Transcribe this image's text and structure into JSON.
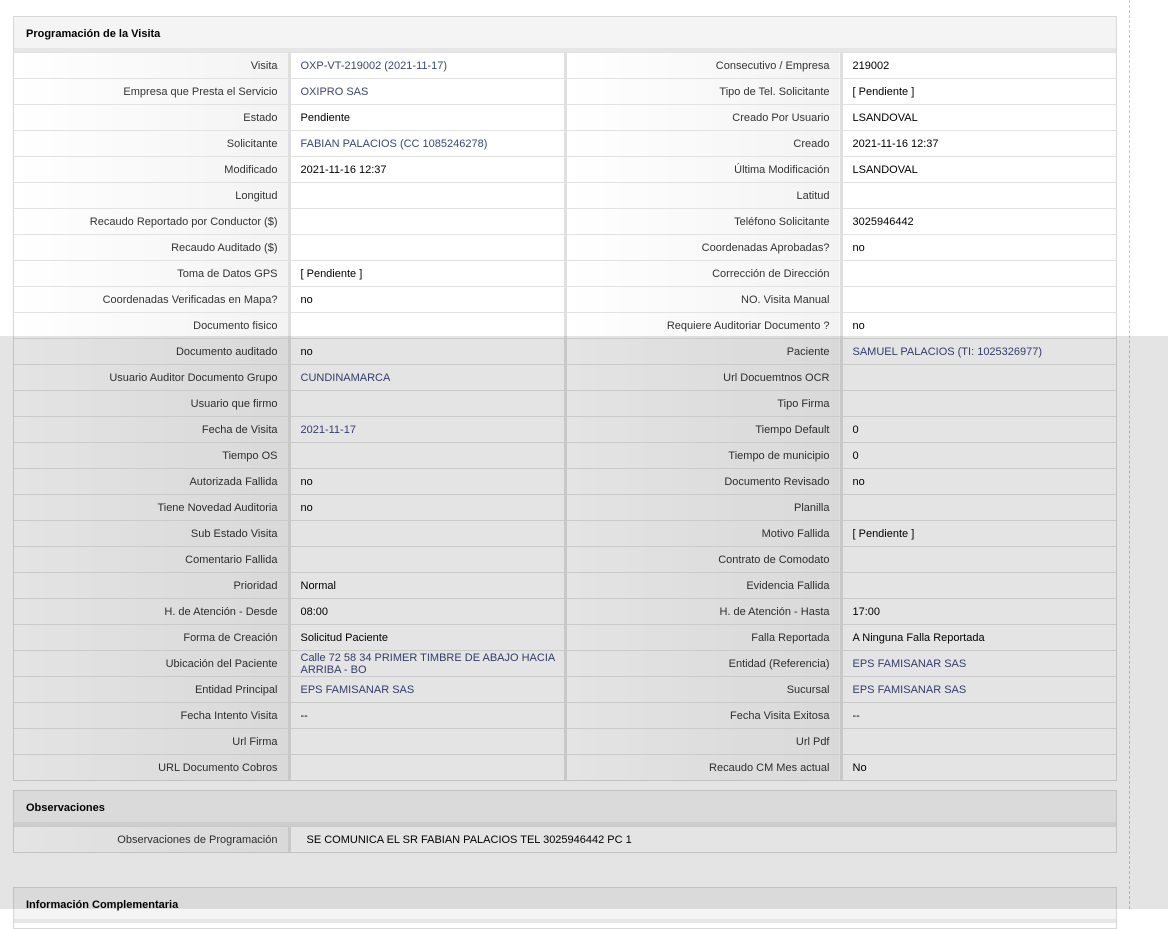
{
  "section1": {
    "title": "Programación de la Visita",
    "rows": [
      {
        "l_label": "Visita",
        "l_value": "OXP-VT-219002 (2021-11-17)",
        "r_label": "Consecutivo / Empresa",
        "r_value": "219002"
      },
      {
        "l_label": "Empresa que Presta el Servicio",
        "l_value": "OXIPRO SAS",
        "r_label": "Tipo de Tel. Solicitante",
        "r_value": "[ Pendiente ]"
      },
      {
        "l_label": "Estado",
        "l_value": "Pendiente",
        "r_label": "Creado Por Usuario",
        "r_value": "LSANDOVAL"
      },
      {
        "l_label": "Solicitante",
        "l_value": "FABIAN PALACIOS (CC 1085246278)",
        "r_label": "Creado",
        "r_value": "2021-11-16 12:37"
      },
      {
        "l_label": "Modificado",
        "l_value": "2021-11-16 12:37",
        "r_label": "Última Modificación",
        "r_value": " LSANDOVAL"
      },
      {
        "l_label": "Longitud",
        "l_value": "",
        "r_label": "Latitud",
        "r_value": ""
      },
      {
        "l_label": "Recaudo Reportado por Conductor ($)",
        "l_value": "",
        "r_label": "Teléfono Solicitante",
        "r_value": "3025946442"
      },
      {
        "l_label": "Recaudo Auditado ($)",
        "l_value": "",
        "r_label": "Coordenadas Aprobadas?",
        "r_value": "no"
      },
      {
        "l_label": "Toma de Datos GPS",
        "l_value": "[ Pendiente ]",
        "r_label": "Corrección de Dirección",
        "r_value": ""
      },
      {
        "l_label": "Coordenadas Verificadas en Mapa?",
        "l_value": "no",
        "r_label": "NO. Visita Manual",
        "r_value": ""
      },
      {
        "l_label": "Documento fisico",
        "l_value": "",
        "r_label": "Requiere Auditoriar Documento ?",
        "r_value": "no"
      },
      {
        "l_label": "Documento auditado",
        "l_value": "no",
        "r_label": "Paciente",
        "r_value": "SAMUEL PALACIOS (TI: 1025326977)"
      },
      {
        "l_label": "Usuario Auditor Documento Grupo",
        "l_value": "CUNDINAMARCA",
        "r_label": "Url Docuemtnos OCR",
        "r_value": ""
      },
      {
        "l_label": "Usuario que firmo",
        "l_value": "",
        "r_label": "Tipo Firma",
        "r_value": ""
      },
      {
        "l_label": "Fecha de Visita",
        "l_value": "2021-11-17",
        "r_label": "Tiempo Default",
        "r_value": "0"
      },
      {
        "l_label": "Tiempo OS",
        "l_value": "",
        "r_label": "Tiempo de municipio",
        "r_value": "0"
      },
      {
        "l_label": "Autorizada Fallida",
        "l_value": "no",
        "r_label": "Documento Revisado",
        "r_value": "no"
      },
      {
        "l_label": "Tiene Novedad Auditoria",
        "l_value": "no",
        "r_label": "Planilla",
        "r_value": ""
      },
      {
        "l_label": "Sub Estado Visita",
        "l_value": "",
        "r_label": "Motivo Fallida",
        "r_value": "[ Pendiente ]"
      },
      {
        "l_label": "Comentario Fallida",
        "l_value": "",
        "r_label": "Contrato de Comodato",
        "r_value": ""
      },
      {
        "l_label": "Prioridad",
        "l_value": "Normal",
        "r_label": "Evidencia Fallida",
        "r_value": ""
      },
      {
        "l_label": "H. de Atención - Desde",
        "l_value": "08:00",
        "r_label": "H. de Atención - Hasta",
        "r_value": "17:00"
      },
      {
        "l_label": "Forma de Creación",
        "l_value": "Solicitud Paciente",
        "r_label": "Falla Reportada",
        "r_value": "A Ninguna Falla Reportada"
      },
      {
        "l_label": "Ubicación del Paciente",
        "l_value": "Calle 72 58 34 PRIMER TIMBRE DE ABAJO HACIA ARRIBA - BO",
        "r_label": "Entidad (Referencia)",
        "r_value": "EPS FAMISANAR SAS"
      },
      {
        "l_label": "Entidad Principal",
        "l_value": "EPS FAMISANAR SAS",
        "r_label": "Sucursal",
        "r_value": "EPS FAMISANAR SAS"
      },
      {
        "l_label": "Fecha Intento Visita",
        "l_value": "--",
        "r_label": "Fecha Visita Exitosa",
        "r_value": "--"
      },
      {
        "l_label": "Url Firma",
        "l_value": "",
        "r_label": "Url Pdf",
        "r_value": ""
      },
      {
        "l_label": "URL Documento Cobros",
        "l_value": "",
        "r_label": "Recaudo CM Mes actual",
        "r_value": "No"
      }
    ]
  },
  "section2": {
    "title": "Observaciones",
    "label": "Observaciones de Programación",
    "value": "SE COMUNICA EL SR FABIAN PALACIOS TEL 3025946442 PC 1"
  },
  "section3": {
    "title": "Información Complementaria"
  }
}
